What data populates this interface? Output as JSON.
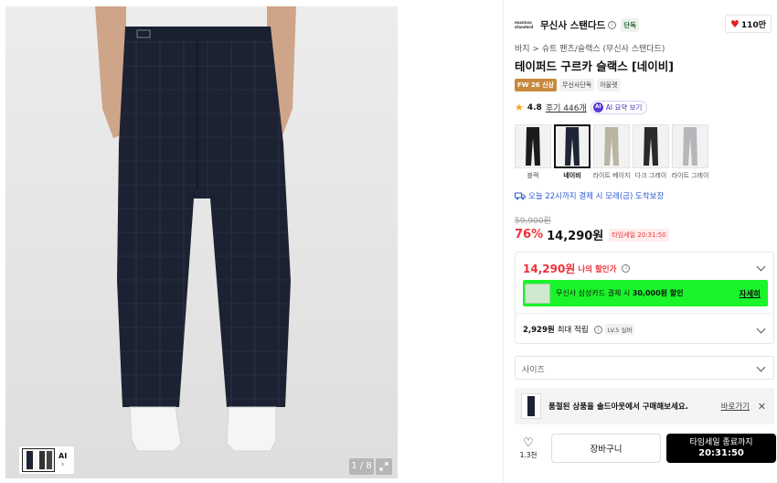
{
  "gallery": {
    "counter": "1 / 8",
    "thumb_ai": "AI"
  },
  "brand": {
    "logo_top": "musinsa",
    "logo_bottom": "standard",
    "name": "무신사 스탠다드",
    "exclusive": "단독"
  },
  "likes": "110만",
  "breadcrumb": "바지 > 슈트 팬츠/슬랙스 (무신사 스탠다드)",
  "title": "테이퍼드 구르카 슬랙스 [네이비]",
  "tags": [
    "FW 26 신상",
    "무신사단독",
    "아울렛"
  ],
  "rating": {
    "score": "4.8",
    "reviews": "후기 446개",
    "ai_dot": "AI",
    "ai_label": "AI 요약 보기"
  },
  "swatches": [
    {
      "label": "블랙",
      "color": "#1b1b1b",
      "selected": false
    },
    {
      "label": "네이비",
      "color": "#1e2536",
      "selected": true
    },
    {
      "label": "라이트 베이지",
      "color": "#b9b4a3",
      "selected": false
    },
    {
      "label": "다크 그레이",
      "color": "#2a2a2c",
      "selected": false
    },
    {
      "label": "라이트 그레이",
      "color": "#b7b7bb",
      "selected": false
    }
  ],
  "delivery": "오늘 22시까지 결제 시 모레(금) 도착보장",
  "price": {
    "original": "59,900원",
    "discount": "76%",
    "current": "14,290원",
    "timesale": "타임세일 20:31:50"
  },
  "benefit": {
    "my_price": "14,290원",
    "my_price_label": "나의 할인가",
    "card_text_1": "무신사 삼성카드 결제 시 ",
    "card_text_bold": "30,000원 할인",
    "card_link": "자세히",
    "points_amount": "2,929원",
    "points_label": "최대 적립",
    "level": "LV.5 실버"
  },
  "size_placeholder": "사이즈",
  "soldout": {
    "text": "품절된 상품을 솔드아웃에서 구매해보세요.",
    "link": "바로가기",
    "close": "✕"
  },
  "actions": {
    "like_count": "1.3천",
    "cart": "장바구니",
    "buy_line1": "타임세일 종료까지",
    "buy_line2": "20:31:50"
  },
  "colors": {
    "accent_red": "#f0303a",
    "card_green": "#19f52a",
    "delivery_blue": "#2b5ad6"
  }
}
